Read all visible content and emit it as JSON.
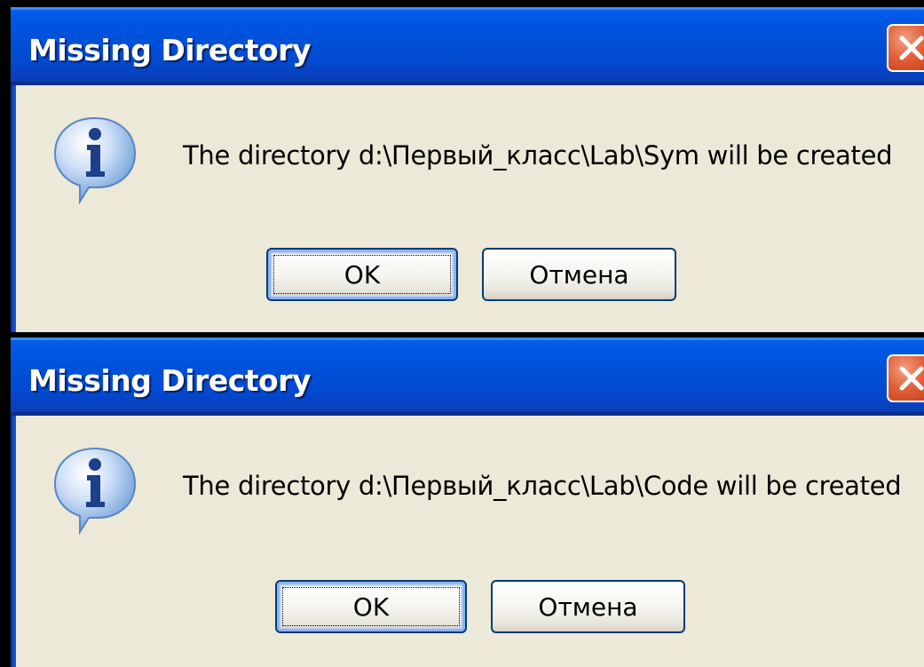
{
  "dialogs": [
    {
      "title": "Missing Directory",
      "icon": "info-icon",
      "message": "The directory d:\\Первый_класс\\Lab\\Sym will be created",
      "ok_label": "OK",
      "cancel_label": "Отмена"
    },
    {
      "title": "Missing Directory",
      "icon": "info-icon",
      "message": "The directory d:\\Первый_класс\\Lab\\Code will be created",
      "ok_label": "OK",
      "cancel_label": "Отмена"
    }
  ],
  "colors": {
    "titlebar": "#0050d8",
    "dialog_body": "#ece9d8",
    "close_button": "#e2613a",
    "button_border": "#003c74"
  }
}
